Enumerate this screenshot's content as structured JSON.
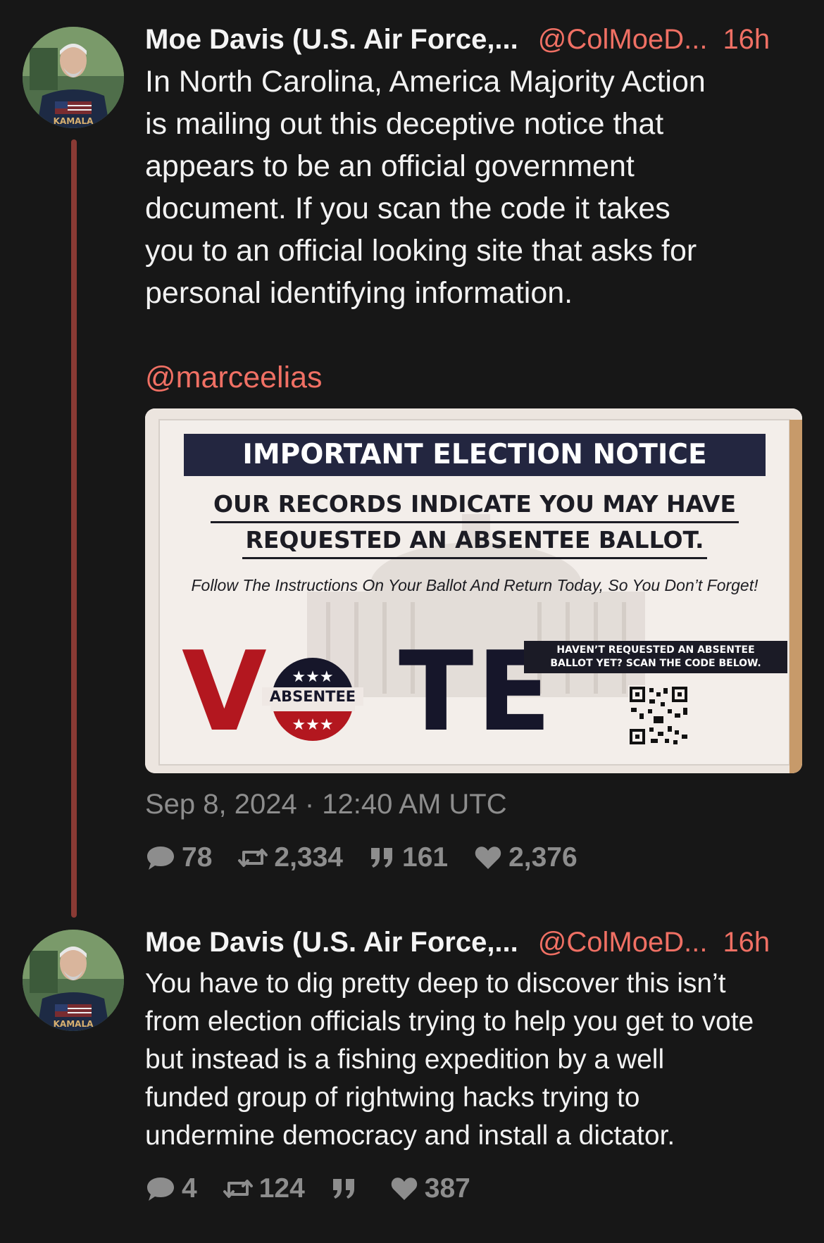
{
  "thread": {
    "tweets": [
      {
        "author": "Moe Davis (U.S. Air Force,...",
        "handle": "@ColMoeD...",
        "time": "16h",
        "text": "In North Carolina, America Majority Action\nis mailing out this deceptive notice that\nappears to be an official government\ndocument.  If you scan the code it takes\nyou to an official looking site that asks for\npersonal identifying information.",
        "mention": "@marceelias",
        "timestamp": "Sep 8, 2024 · 12:40 AM UTC",
        "stats": {
          "replies": "78",
          "retweets": "2,334",
          "quotes": "161",
          "likes": "2,376"
        },
        "avatar_shirt_text": "KAMALA"
      },
      {
        "author": "Moe Davis (U.S. Air Force,...",
        "handle": "@ColMoeD...",
        "time": "16h",
        "text": "You have to dig pretty deep to discover this isn’t\nfrom election officials trying to help you get to vote\nbut instead is a fishing expedition by a well\nfunded group of rightwing hacks trying to\nundermine democracy and install a dictator.",
        "stats": {
          "replies": "4",
          "retweets": "124",
          "quotes": "",
          "likes": "387"
        },
        "avatar_shirt_text": "KAMALA"
      }
    ]
  },
  "media": {
    "banner": "IMPORTANT ELECTION NOTICE",
    "sub_line1": "OUR RECORDS INDICATE YOU MAY HAVE",
    "sub_line2": "REQUESTED AN ABSENTEE BALLOT.",
    "follow": "Follow The Instructions On Your Ballot And Return Today, So You Don’t Forget!",
    "vote_v": "V",
    "vote_te": "TE",
    "badge_label": "ABSENTEE",
    "scan_line1": "HAVEN’T REQUESTED AN ABSENTEE",
    "scan_line2": "BALLOT YET? SCAN THE CODE BELOW."
  },
  "colors": {
    "background": "#171717",
    "accent": "#f07064",
    "muted": "#8d8d8d",
    "thread_line": "#8a3a34"
  },
  "icons": {
    "reply": "comment-icon",
    "retweet": "retweet-icon",
    "quote": "quote-icon",
    "like": "heart-icon"
  }
}
